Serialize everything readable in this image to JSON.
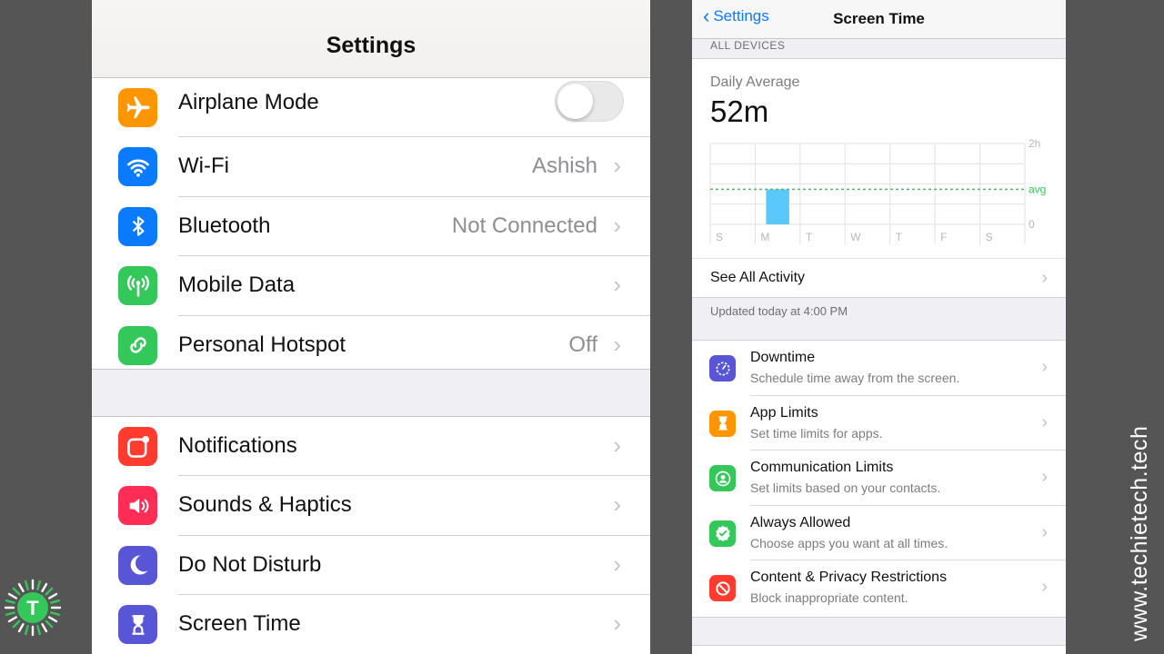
{
  "left_screen": {
    "title": "Settings",
    "group1": [
      {
        "label": "Airplane Mode",
        "icon": "airplane-icon",
        "color": "#ff9500",
        "toggle": "off"
      },
      {
        "label": "Wi-Fi",
        "value": "Ashish",
        "icon": "wifi-icon",
        "color": "#0a7aff"
      },
      {
        "label": "Bluetooth",
        "value": "Not Connected",
        "icon": "bluetooth-icon",
        "color": "#0a7aff"
      },
      {
        "label": "Mobile Data",
        "icon": "antenna-icon",
        "color": "#34c759"
      },
      {
        "label": "Personal Hotspot",
        "value": "Off",
        "icon": "hotspot-icon",
        "color": "#34c759"
      }
    ],
    "group2": [
      {
        "label": "Notifications",
        "icon": "notifications-icon",
        "color": "#ff3b30"
      },
      {
        "label": "Sounds & Haptics",
        "icon": "speaker-icon",
        "color": "#ff2d55"
      },
      {
        "label": "Do Not Disturb",
        "icon": "moon-icon",
        "color": "#5856d6"
      },
      {
        "label": "Screen Time",
        "icon": "hourglass-icon",
        "color": "#5856d6"
      }
    ]
  },
  "right_screen": {
    "back_label": "Settings",
    "title": "Screen Time",
    "section_header": "ALL DEVICES",
    "daily_average_label": "Daily Average",
    "daily_average_value": "52m",
    "see_all": "See All Activity",
    "updated": "Updated today at 4:00 PM",
    "options": [
      {
        "title": "Downtime",
        "subtitle": "Schedule time away from the screen.",
        "icon": "downtime-icon",
        "color": "#5856d6"
      },
      {
        "title": "App Limits",
        "subtitle": "Set time limits for apps.",
        "icon": "hourglass-icon",
        "color": "#ff9500"
      },
      {
        "title": "Communication Limits",
        "subtitle": "Set limits based on your contacts.",
        "icon": "contact-icon",
        "color": "#34c759"
      },
      {
        "title": "Always Allowed",
        "subtitle": "Choose apps you want at all times.",
        "icon": "checkmark-icon",
        "color": "#34c759"
      },
      {
        "title": "Content & Privacy Restrictions",
        "subtitle": "Block inappropriate content.",
        "icon": "restriction-icon",
        "color": "#ff3b30"
      }
    ]
  },
  "chart_data": {
    "type": "bar",
    "categories": [
      "S",
      "M",
      "T",
      "W",
      "T",
      "F",
      "S"
    ],
    "values": [
      0,
      52,
      0,
      0,
      0,
      0,
      0
    ],
    "unit": "minutes",
    "y_ticks": [
      "2h",
      "avg",
      "0"
    ],
    "ylim": [
      0,
      120
    ],
    "average": 52,
    "bar_color": "#5ac8fa",
    "avg_line_color": "#34c759",
    "grid": true
  },
  "branding": {
    "logo_letter": "T",
    "logo_color": "#34c759",
    "watermark": "www.techietech.tech"
  }
}
